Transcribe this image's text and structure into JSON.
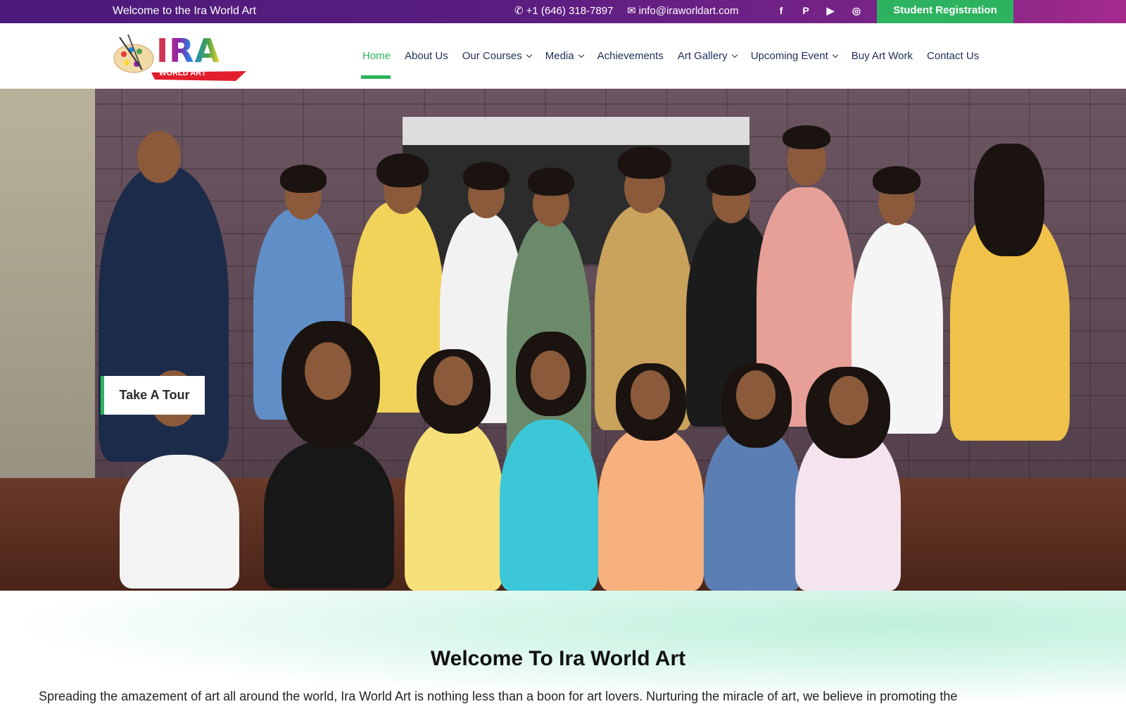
{
  "topbar": {
    "welcome": "Welcome to the Ira World Art",
    "phone": "+1 (646) 318-7897",
    "email": "info@iraworldart.com",
    "social": [
      {
        "icon": "facebook-icon",
        "glyph": "f"
      },
      {
        "icon": "pinterest-icon",
        "glyph": "P"
      },
      {
        "icon": "youtube-icon",
        "glyph": "▶"
      },
      {
        "icon": "instagram-icon",
        "glyph": "◎"
      }
    ],
    "registration_label": "Student Registration"
  },
  "logo": {
    "main_text": "IRA",
    "sub_text": "WORLD ART"
  },
  "nav": {
    "items": [
      {
        "label": "Home",
        "active": true,
        "dropdown": false
      },
      {
        "label": "About Us",
        "active": false,
        "dropdown": false
      },
      {
        "label": "Our Courses",
        "active": false,
        "dropdown": true
      },
      {
        "label": "Media",
        "active": false,
        "dropdown": true
      },
      {
        "label": "Achievements",
        "active": false,
        "dropdown": false
      },
      {
        "label": "Art Gallery",
        "active": false,
        "dropdown": true
      },
      {
        "label": "Upcoming Event",
        "active": false,
        "dropdown": true
      },
      {
        "label": "Buy Art Work",
        "active": false,
        "dropdown": false
      },
      {
        "label": "Contact Us",
        "active": false,
        "dropdown": false
      }
    ]
  },
  "hero": {
    "tour_button": "Take A Tour"
  },
  "welcome_section": {
    "heading": "Welcome To Ira World Art",
    "body": "Spreading the amazement of art all around the world, Ira World Art is nothing less than a boon for art lovers. Nurturing the miracle of art, we believe in promoting the"
  },
  "colors": {
    "accent": "#2db35f",
    "topbar_start": "#4b1a7a",
    "topbar_end": "#a52a8c",
    "nav_text": "#1f2d5a"
  }
}
